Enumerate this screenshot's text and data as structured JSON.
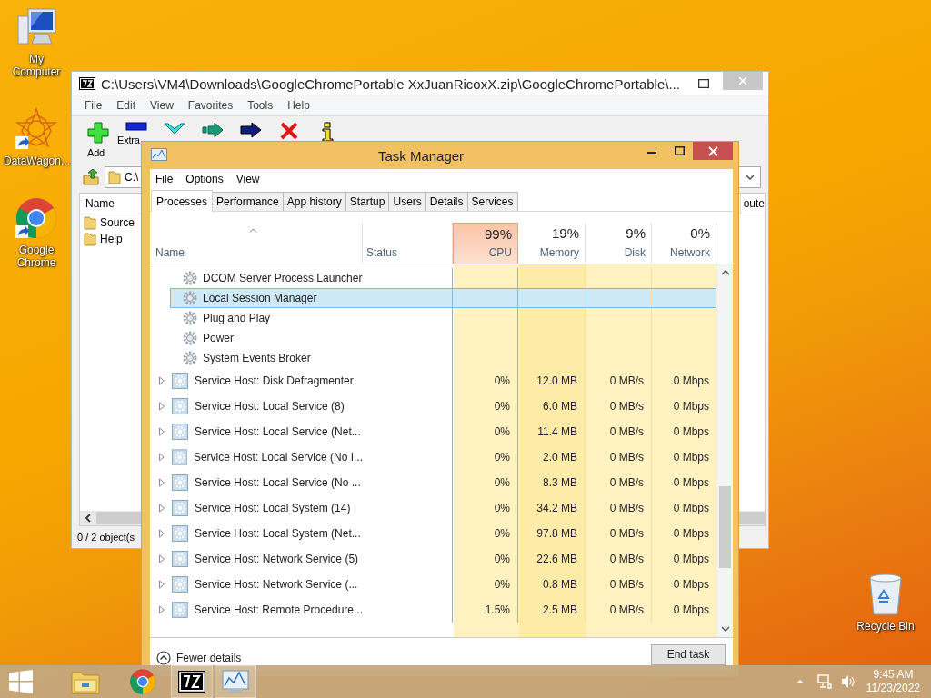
{
  "desktop_icons": [
    {
      "label": "My Computer",
      "kind": "computer"
    },
    {
      "label": "DataWagon...",
      "kind": "star"
    },
    {
      "label": "Google Chrome",
      "kind": "chrome"
    }
  ],
  "recycle_bin": {
    "label": "Recycle Bin"
  },
  "archive_window": {
    "title": "C:\\Users\\VM4\\Downloads\\GoogleChromePortable XxJuanRicoxX.zip\\GoogleChromePortable\\...",
    "menu": [
      "File",
      "Edit",
      "View",
      "Favorites",
      "Tools",
      "Help"
    ],
    "toolbar": [
      {
        "label": "Add"
      },
      {
        "label": "Extra"
      }
    ],
    "address": "C:\\",
    "columns": [
      "Name",
      "oute"
    ],
    "items": [
      "Source",
      "Help"
    ],
    "status": "0 / 2 object(s"
  },
  "task_manager": {
    "title": "Task Manager",
    "menu": [
      "File",
      "Options",
      "View"
    ],
    "tabs": [
      {
        "label": "Processes",
        "selected": true
      },
      {
        "label": "Performance",
        "selected": false
      },
      {
        "label": "App history",
        "selected": false
      },
      {
        "label": "Startup",
        "selected": false
      },
      {
        "label": "Users",
        "selected": false
      },
      {
        "label": "Details",
        "selected": false
      },
      {
        "label": "Services",
        "selected": false
      }
    ],
    "columns": [
      {
        "label": "Name"
      },
      {
        "label": "Status"
      },
      {
        "label": "CPU",
        "usage": "99%",
        "highlighted": true
      },
      {
        "label": "Memory",
        "usage": "19%",
        "highlighted": false
      },
      {
        "label": "Disk",
        "usage": "9%",
        "highlighted": false
      },
      {
        "label": "Network",
        "usage": "0%",
        "highlighted": false
      }
    ],
    "rows": [
      {
        "kind": "service",
        "name": "DCOM Server Process Launcher",
        "selected": false
      },
      {
        "kind": "service",
        "name": "Local Session Manager",
        "selected": true
      },
      {
        "kind": "service",
        "name": "Plug and Play",
        "selected": false
      },
      {
        "kind": "service",
        "name": "Power",
        "selected": false
      },
      {
        "kind": "service",
        "name": "System Events Broker",
        "selected": false
      },
      {
        "kind": "group",
        "name": "Service Host: Disk Defragmenter",
        "cpu": "0%",
        "memory": "12.0 MB",
        "disk": "0 MB/s",
        "network": "0 Mbps",
        "selected": false
      },
      {
        "kind": "group",
        "name": "Service Host: Local Service (8)",
        "cpu": "0%",
        "memory": "6.0 MB",
        "disk": "0 MB/s",
        "network": "0 Mbps",
        "selected": false
      },
      {
        "kind": "group",
        "name": "Service Host: Local Service (Net...",
        "cpu": "0%",
        "memory": "11.4 MB",
        "disk": "0 MB/s",
        "network": "0 Mbps",
        "selected": false
      },
      {
        "kind": "group",
        "name": "Service Host: Local Service (No I...",
        "cpu": "0%",
        "memory": "2.0 MB",
        "disk": "0 MB/s",
        "network": "0 Mbps",
        "selected": false
      },
      {
        "kind": "group",
        "name": "Service Host: Local Service (No ...",
        "cpu": "0%",
        "memory": "8.3 MB",
        "disk": "0 MB/s",
        "network": "0 Mbps",
        "selected": false
      },
      {
        "kind": "group",
        "name": "Service Host: Local System (14)",
        "cpu": "0%",
        "memory": "34.2 MB",
        "disk": "0 MB/s",
        "network": "0 Mbps",
        "selected": false
      },
      {
        "kind": "group",
        "name": "Service Host: Local System (Net...",
        "cpu": "0%",
        "memory": "97.8 MB",
        "disk": "0 MB/s",
        "network": "0 Mbps",
        "selected": false
      },
      {
        "kind": "group",
        "name": "Service Host: Network Service (5)",
        "cpu": "0%",
        "memory": "22.6 MB",
        "disk": "0 MB/s",
        "network": "0 Mbps",
        "selected": false
      },
      {
        "kind": "group",
        "name": "Service Host: Network Service (...",
        "cpu": "0%",
        "memory": "0.8 MB",
        "disk": "0 MB/s",
        "network": "0 Mbps",
        "selected": false
      },
      {
        "kind": "group",
        "name": "Service Host: Remote Procedure...",
        "cpu": "1.5%",
        "memory": "2.5 MB",
        "disk": "0 MB/s",
        "network": "0 Mbps",
        "selected": false
      }
    ],
    "fewer_details": "Fewer details",
    "end_task": "End task"
  },
  "taskbar": {
    "time": "9:45 AM",
    "date": "11/23/2022"
  }
}
